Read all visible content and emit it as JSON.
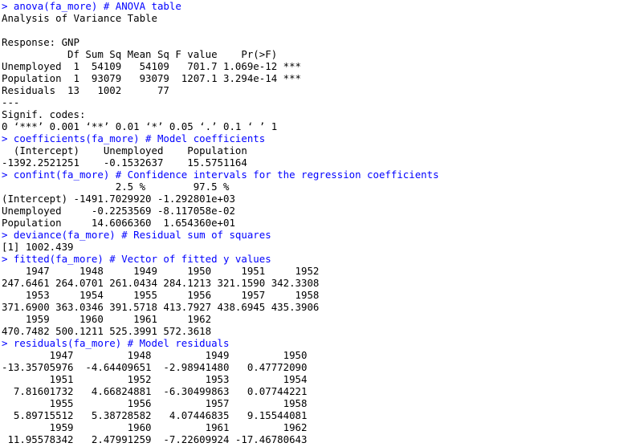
{
  "colors": {
    "background": "#ffffff",
    "command_text": "#0000ff",
    "output_text": "#000000"
  },
  "console": {
    "lines": [
      {
        "type": "cmd",
        "text": "> anova(fa_more) # ANOVA table"
      },
      {
        "type": "out",
        "text": "Analysis of Variance Table"
      },
      {
        "type": "out",
        "text": ""
      },
      {
        "type": "out",
        "text": "Response: GNP"
      },
      {
        "type": "out",
        "text": "           Df Sum Sq Mean Sq F value    Pr(>F)    "
      },
      {
        "type": "out",
        "text": "Unemployed  1  54109   54109   701.7 1.069e-12 ***"
      },
      {
        "type": "out",
        "text": "Population  1  93079   93079  1207.1 3.294e-14 ***"
      },
      {
        "type": "out",
        "text": "Residuals  13   1002      77                      "
      },
      {
        "type": "out",
        "text": "---"
      },
      {
        "type": "out",
        "text": "Signif. codes:  "
      },
      {
        "type": "out",
        "text": "0 ‘***’ 0.001 ‘**’ 0.01 ‘*’ 0.05 ‘.’ 0.1 ‘ ’ 1"
      },
      {
        "type": "cmd",
        "text": "> coefficients(fa_more) # Model coefficients"
      },
      {
        "type": "out",
        "text": "  (Intercept)    Unemployed    Population "
      },
      {
        "type": "out",
        "text": "-1392.2521251    -0.1532637    15.5751164 "
      },
      {
        "type": "cmd",
        "text": "> confint(fa_more) # Confidence intervals for the regression coefficients"
      },
      {
        "type": "out",
        "text": "                   2.5 %        97.5 %"
      },
      {
        "type": "out",
        "text": "(Intercept) -1491.7029920 -1.292801e+03"
      },
      {
        "type": "out",
        "text": "Unemployed     -0.2253569 -8.117058e-02"
      },
      {
        "type": "out",
        "text": "Population     14.6066360  1.654360e+01"
      },
      {
        "type": "cmd",
        "text": "> deviance(fa_more) # Residual sum of squares"
      },
      {
        "type": "out",
        "text": "[1] 1002.439"
      },
      {
        "type": "cmd",
        "text": "> fitted(fa_more) # Vector of fitted y values"
      },
      {
        "type": "out",
        "text": "    1947     1948     1949     1950     1951     1952 "
      },
      {
        "type": "out",
        "text": "247.6461 264.0701 261.0434 284.1213 321.1590 342.3308 "
      },
      {
        "type": "out",
        "text": "    1953     1954     1955     1956     1957     1958 "
      },
      {
        "type": "out",
        "text": "371.6900 363.0346 391.5718 413.7927 438.6945 435.3906 "
      },
      {
        "type": "out",
        "text": "    1959     1960     1961     1962 "
      },
      {
        "type": "out",
        "text": "470.7482 500.1211 525.3991 572.3618 "
      },
      {
        "type": "cmd",
        "text": "> residuals(fa_more) # Model residuals"
      },
      {
        "type": "out",
        "text": "        1947         1948         1949         1950 "
      },
      {
        "type": "out",
        "text": "-13.35705976  -4.64409651  -2.98941480   0.47772090 "
      },
      {
        "type": "out",
        "text": "        1951         1952         1953         1954 "
      },
      {
        "type": "out",
        "text": "  7.81601732   4.66824881  -6.30499863   0.07744221 "
      },
      {
        "type": "out",
        "text": "        1955         1956         1957         1958 "
      },
      {
        "type": "out",
        "text": "  5.89715512   5.38728582   4.07446835   9.15544081 "
      },
      {
        "type": "out",
        "text": "        1959         1960         1961         1962 "
      },
      {
        "type": "out",
        "text": " 11.95578342   2.47991259  -7.22609924 -17.46780643 "
      }
    ]
  }
}
